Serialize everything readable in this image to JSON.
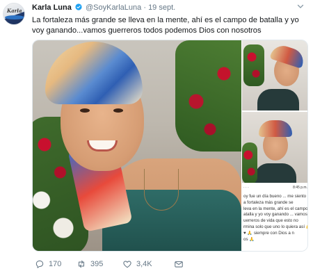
{
  "tweet": {
    "display_name": "Karla Luna",
    "handle": "@SoyKarlaLuna",
    "separator": "·",
    "date": "19 sept.",
    "text": "La fortaleza más grande se lleva en la mente, ahí es el campo de batalla y yo voy ganando...vamos guerreros todos podemos Dios con nosotros"
  },
  "media": {
    "note": {
      "status_left": "· · ·",
      "status_right": "8:45 p.m.",
      "lines": [
        "oy fue un día bueno ... me siento",
        "a fortaleza más grande se",
        "leva en la mente, ahí es el campo de",
        "atalla y yo voy ganando ... vamos",
        "uerreros de vida que esto no",
        "rmina solo que uno lo quiera así 💪",
        "♥ 🙏 siempre con Dios a n",
        "os 🙏"
      ]
    }
  },
  "actions": {
    "replies": "170",
    "retweets": "395",
    "likes": "3,4K"
  },
  "colors": {
    "text": "#14171a",
    "muted": "#657786",
    "verified": "#1da1f2"
  }
}
